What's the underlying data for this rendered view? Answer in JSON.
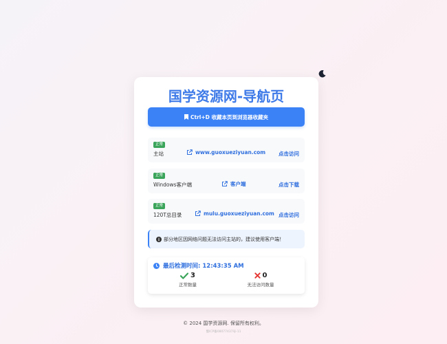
{
  "header": {
    "title": "国学资源网-导航页",
    "theme_toggle_icon": "moon-icon"
  },
  "bookmark": {
    "icon": "bookmark-icon",
    "label": "Ctrl+D 收藏本页到浏览器收藏夹"
  },
  "sites": [
    {
      "status": "正常",
      "name": "主站",
      "url": "www.guoxueziyuan.com",
      "action": "点击访问"
    },
    {
      "status": "正常",
      "name": "Windows客户端",
      "url": "客户端",
      "action": "点击下载"
    },
    {
      "status": "正常",
      "name": "120T总目录",
      "url": "mulu.guoxueziyuan.com",
      "action": "点击访问"
    }
  ],
  "notice": {
    "icon": "info-circle-icon",
    "text": "部分地区因网络问题无法访问主站的，建议使用客户端！"
  },
  "stats": {
    "icon": "clock-icon",
    "last_check_label": "最后检测时间: 12:43:35 AM",
    "ok_count": "3",
    "ok_label": "正常数量",
    "fail_count": "0",
    "fail_label": "无法访问数量"
  },
  "footer": {
    "copyright": "© 2024 国学资源网. 保留所有权利。",
    "icp": "蜀ICP备08077437号-11"
  },
  "colors": {
    "accent": "#3b82f6",
    "title": "#3f7be8",
    "ok_green": "#3aa55a",
    "fail_red": "#e53935"
  }
}
